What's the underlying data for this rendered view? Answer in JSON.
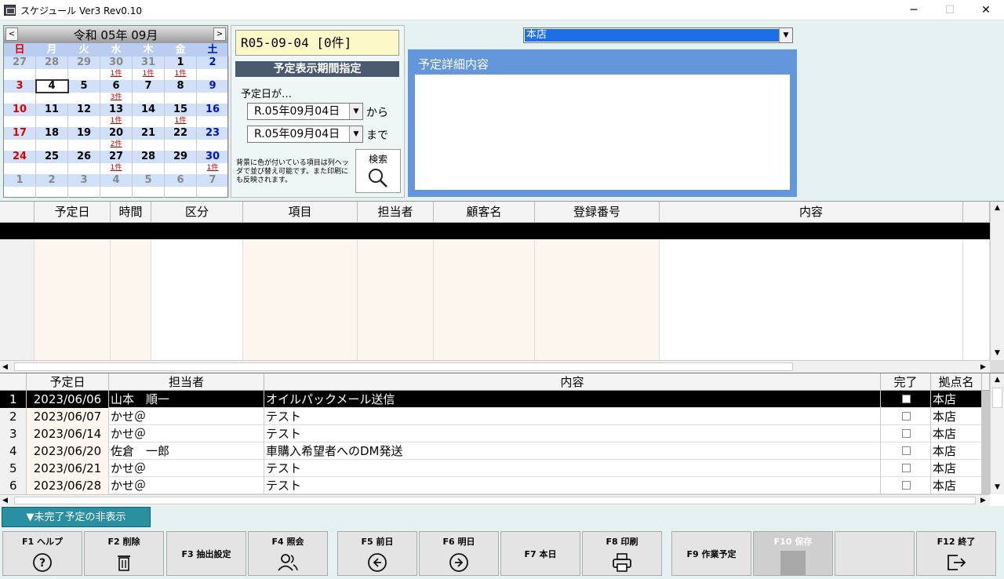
{
  "window": {
    "title": "スケジュール Ver3 Rev0.10",
    "minimize": "─",
    "maximize": "☐",
    "close": "✕"
  },
  "calendar": {
    "title": "令和 05年 09月",
    "prev": "<",
    "next": ">",
    "weekdays": [
      "日",
      "月",
      "火",
      "水",
      "木",
      "金",
      "土"
    ],
    "weeks": [
      {
        "days": [
          "27",
          "28",
          "29",
          "30",
          "31",
          "1",
          "2"
        ],
        "counts": [
          "",
          "",
          "",
          "1件",
          "1件",
          "1件",
          ""
        ]
      },
      {
        "days": [
          "3",
          "4",
          "5",
          "6",
          "7",
          "8",
          "9"
        ],
        "counts": [
          "",
          "",
          "",
          "3件",
          "",
          "",
          ""
        ]
      },
      {
        "days": [
          "10",
          "11",
          "12",
          "13",
          "14",
          "15",
          "16"
        ],
        "counts": [
          "",
          "",
          "",
          "1件",
          "",
          "1件",
          ""
        ]
      },
      {
        "days": [
          "17",
          "18",
          "19",
          "20",
          "21",
          "22",
          "23"
        ],
        "counts": [
          "",
          "",
          "",
          "2件",
          "",
          "",
          ""
        ]
      },
      {
        "days": [
          "24",
          "25",
          "26",
          "27",
          "28",
          "29",
          "30"
        ],
        "counts": [
          "",
          "",
          "",
          "1件",
          "",
          "",
          "1件"
        ]
      },
      {
        "days": [
          "1",
          "2",
          "3",
          "4",
          "5",
          "6",
          "7"
        ],
        "counts": [
          "",
          "",
          "",
          "",
          "",
          "",
          ""
        ]
      }
    ]
  },
  "date_panel": {
    "display": "R05-09-04 [0件]",
    "period_header": "予定表示期間指定",
    "label": "予定日が…",
    "from_value": "R.05年09月04日",
    "from_suffix": "から",
    "to_value": "R.05年09月04日",
    "to_suffix": "まで",
    "hint": "背景に色が付いている項目は列ヘッダで並び替え可能です。また印刷にも反映されます。",
    "search_label": "検索"
  },
  "store": {
    "selected": "本店"
  },
  "detail": {
    "title": "予定詳細内容"
  },
  "grid1": {
    "columns": [
      "予定日",
      "時間",
      "区分",
      "項目",
      "担当者",
      "顧客名",
      "登録番号",
      "内容"
    ]
  },
  "grid2": {
    "columns": [
      "予定日",
      "担当者",
      "内容",
      "完了",
      "拠点名"
    ],
    "rows": [
      {
        "no": "1",
        "date": "2023/06/06",
        "person": "山本　順一",
        "content": "オイルパックメール送信",
        "done": false,
        "store": "本店"
      },
      {
        "no": "2",
        "date": "2023/06/07",
        "person": "かせ＠",
        "content": "テスト",
        "done": false,
        "store": "本店"
      },
      {
        "no": "3",
        "date": "2023/06/14",
        "person": "かせ＠",
        "content": "テスト",
        "done": false,
        "store": "本店"
      },
      {
        "no": "4",
        "date": "2023/06/20",
        "person": "佐倉　一郎",
        "content": "車購入希望者へのDM発送",
        "done": false,
        "store": "本店"
      },
      {
        "no": "5",
        "date": "2023/06/21",
        "person": "かせ＠",
        "content": "テスト",
        "done": false,
        "store": "本店"
      },
      {
        "no": "6",
        "date": "2023/06/28",
        "person": "かせ＠",
        "content": "テスト",
        "done": false,
        "store": "本店"
      }
    ]
  },
  "toggle": {
    "label": "▼未完了予定の非表示"
  },
  "fkeys": {
    "f1": "F1 ヘルプ",
    "f2": "F2 削除",
    "f3": "F3 抽出設定",
    "f4": "F4 照会",
    "f5": "F5 前日",
    "f6": "F6 明日",
    "f7": "F7 本日",
    "f8": "F8 印刷",
    "f9": "F9 作業予定",
    "f10": "F10 保存",
    "f11": "",
    "f12": "F12 終了"
  },
  "colors": {
    "sunday": "#e00000",
    "saturday": "#0010d0",
    "muted": "#888888",
    "accent": "#6496dc",
    "selection": "#1d6fe8"
  }
}
